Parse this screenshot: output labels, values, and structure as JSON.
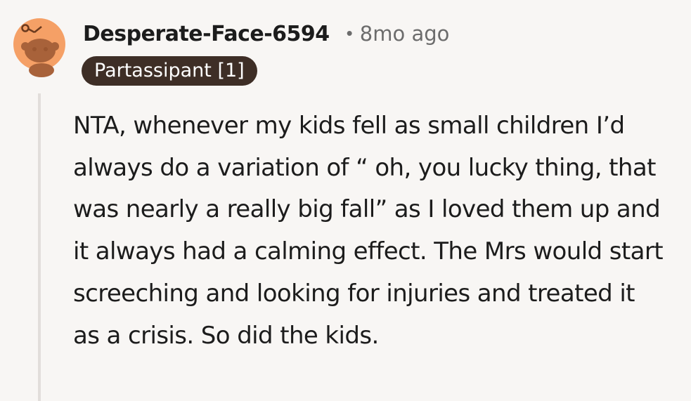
{
  "comment": {
    "author": "Desperate-Face-6594",
    "separator": "•",
    "timestamp": "8mo ago",
    "flair": "Partassipant [1]",
    "avatar": {
      "icon": "snoo-avatar-icon",
      "background_color": "#f5a066",
      "figure_color": "#a8623a"
    },
    "body": "NTA, whenever my kids fell as small children I’d always do a variation of “ oh, you lucky thing, that was nearly a really big fall” as I loved them up and it always had a calming effect. The Mrs would start screeching and looking for injuries and treated it as a crisis. So did the kids."
  }
}
